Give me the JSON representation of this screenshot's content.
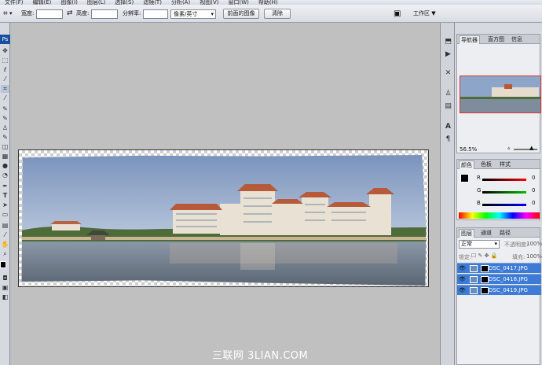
{
  "menubar": {
    "items": [
      "文件(F)",
      "编辑(E)",
      "图像(I)",
      "图层(L)",
      "选择(S)",
      "滤镜(T)",
      "分析(A)",
      "视图(V)",
      "窗口(W)",
      "帮助(H)"
    ]
  },
  "options": {
    "width_label": "宽度:",
    "height_label": "高度:",
    "resolution_label": "分辨率:",
    "unit": "像素/英寸",
    "front_image_button": "前面的图像",
    "clear_button": "清除",
    "workspace": "工作区 ▼"
  },
  "toolbox": {
    "badge": "Ps"
  },
  "watermark": "三联网 3LIAN.COM",
  "navigator": {
    "tabs": [
      "导航器",
      "直方图",
      "信息"
    ],
    "zoom": "56.5%"
  },
  "color": {
    "tabs": [
      "颜色",
      "色板",
      "样式"
    ],
    "channels": [
      {
        "name": "R",
        "value": "0"
      },
      {
        "name": "G",
        "value": "0"
      },
      {
        "name": "B",
        "value": "0"
      }
    ]
  },
  "layers": {
    "tabs": [
      "图层",
      "通道",
      "路径"
    ],
    "blend_mode": "正常",
    "opacity_label": "不透明度:",
    "opacity": "100%",
    "lock_label": "锁定:",
    "fill_label": "填充:",
    "fill": "100%",
    "rows": [
      "DSC_0417.JPG",
      "DSC_0418.JPG",
      "DSC_0419.JPG"
    ]
  },
  "colors": {
    "accent": "#3d7bd6",
    "ps_blue": "#1b4fa0",
    "nav_frame": "#e03030"
  }
}
